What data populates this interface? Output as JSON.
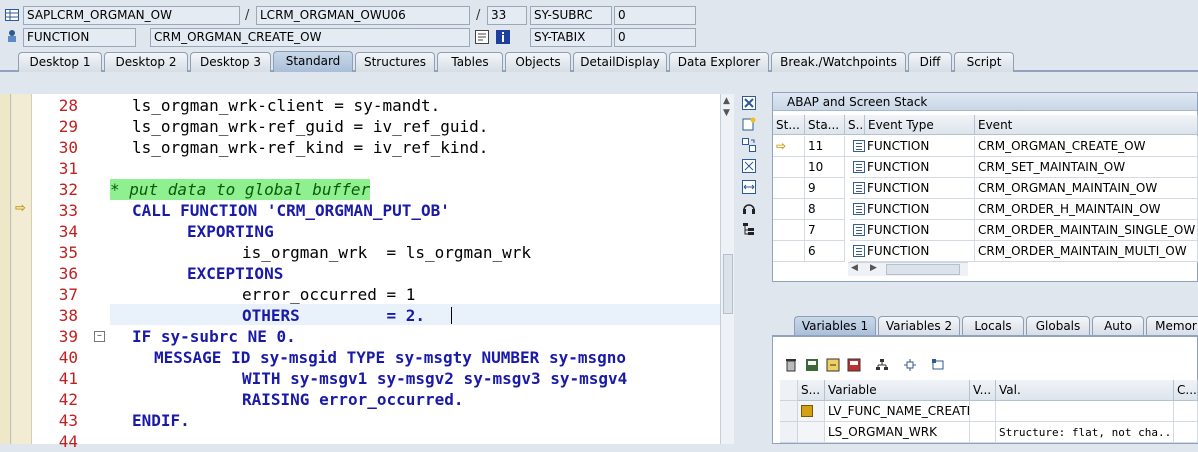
{
  "header": {
    "program": "SAPLCRM_ORGMAN_OW",
    "include": "LCRM_ORGMAN_OWU06",
    "line_no": "33",
    "subrc_label": "SY-SUBRC",
    "subrc_value": "0",
    "event_type": "FUNCTION",
    "event_name": "CRM_ORGMAN_CREATE_OW",
    "tabix_label": "SY-TABIX",
    "tabix_value": "0",
    "slash1": "/",
    "slash2": "/"
  },
  "tabs": [
    "Desktop 1",
    "Desktop 2",
    "Desktop 3",
    "Standard",
    "Structures",
    "Tables",
    "Objects",
    "DetailDisplay",
    "Data Explorer",
    "Break./Watchpoints",
    "Diff",
    "Script"
  ],
  "code_lines": [
    {
      "n": "28",
      "t": "ls_orgman_wrk-client = sy-mandt."
    },
    {
      "n": "29",
      "t": "ls_orgman_wrk-ref_guid = iv_ref_guid."
    },
    {
      "n": "30",
      "t": "ls_orgman_wrk-ref_kind = iv_ref_kind."
    },
    {
      "n": "31",
      "t": ""
    },
    {
      "n": "32",
      "t": "* put data to global buffer"
    },
    {
      "n": "33",
      "t": "CALL FUNCTION 'CRM_ORGMAN_PUT_OB'"
    },
    {
      "n": "34",
      "t": "EXPORTING"
    },
    {
      "n": "35",
      "t": "is_orgman_wrk  = ls_orgman_wrk"
    },
    {
      "n": "36",
      "t": "EXCEPTIONS"
    },
    {
      "n": "37",
      "t": "error_occurred = 1"
    },
    {
      "n": "38",
      "t": "OTHERS         = 2."
    },
    {
      "n": "39",
      "t": "IF sy-subrc NE 0."
    },
    {
      "n": "40",
      "t": "MESSAGE ID sy-msgid TYPE sy-msgty NUMBER sy-msgno"
    },
    {
      "n": "41",
      "t": "WITH sy-msgv1 sy-msgv2 sy-msgv3 sy-msgv4"
    },
    {
      "n": "42",
      "t": "RAISING error_occurred."
    },
    {
      "n": "43",
      "t": "ENDIF."
    },
    {
      "n": "44",
      "t": ""
    }
  ],
  "stack": {
    "title": "ABAP and Screen Stack",
    "columns": [
      "St...",
      "Sta...",
      "S...",
      "Event Type",
      "Event"
    ],
    "rows": [
      {
        "level": "11",
        "type": "FUNCTION",
        "event": "CRM_ORGMAN_CREATE_OW",
        "current": true
      },
      {
        "level": "10",
        "type": "FUNCTION",
        "event": "CRM_SET_MAINTAIN_OW",
        "current": false
      },
      {
        "level": "9",
        "type": "FUNCTION",
        "event": "CRM_ORGMAN_MAINTAIN_OW",
        "current": false
      },
      {
        "level": "8",
        "type": "FUNCTION",
        "event": "CRM_ORDER_H_MAINTAIN_OW",
        "current": false
      },
      {
        "level": "7",
        "type": "FUNCTION",
        "event": "CRM_ORDER_MAINTAIN_SINGLE_OW",
        "current": false
      },
      {
        "level": "6",
        "type": "FUNCTION",
        "event": "CRM_ORDER_MAINTAIN_MULTI_OW",
        "current": false
      }
    ]
  },
  "var_tabs": [
    "Variables 1",
    "Variables 2",
    "Locals",
    "Globals",
    "Auto",
    "Memor"
  ],
  "vars": {
    "columns": [
      "S...",
      "Variable",
      "V...",
      "Val.",
      "C..."
    ],
    "rows": [
      {
        "name": "LV_FUNC_NAME_CREATE...",
        "value": ""
      },
      {
        "name": "LS_ORGMAN_WRK",
        "value": "Structure: flat, not cha..."
      }
    ]
  },
  "icons": {
    "toolbar": [
      "close-icon",
      "new-icon",
      "swap-icon",
      "fit-icon",
      "expand-icon",
      "headset-icon",
      "tree-icon"
    ],
    "vars_toolbar": [
      "delete-icon",
      "save-icon",
      "import-icon",
      "export-icon",
      "tree-icon",
      "sync-icon",
      "filter-icon"
    ]
  },
  "colors": {
    "comment_bg": "#8ff08f",
    "keyword": "#1a1aa8",
    "line_number": "#c02020",
    "number": "#2050d0"
  }
}
